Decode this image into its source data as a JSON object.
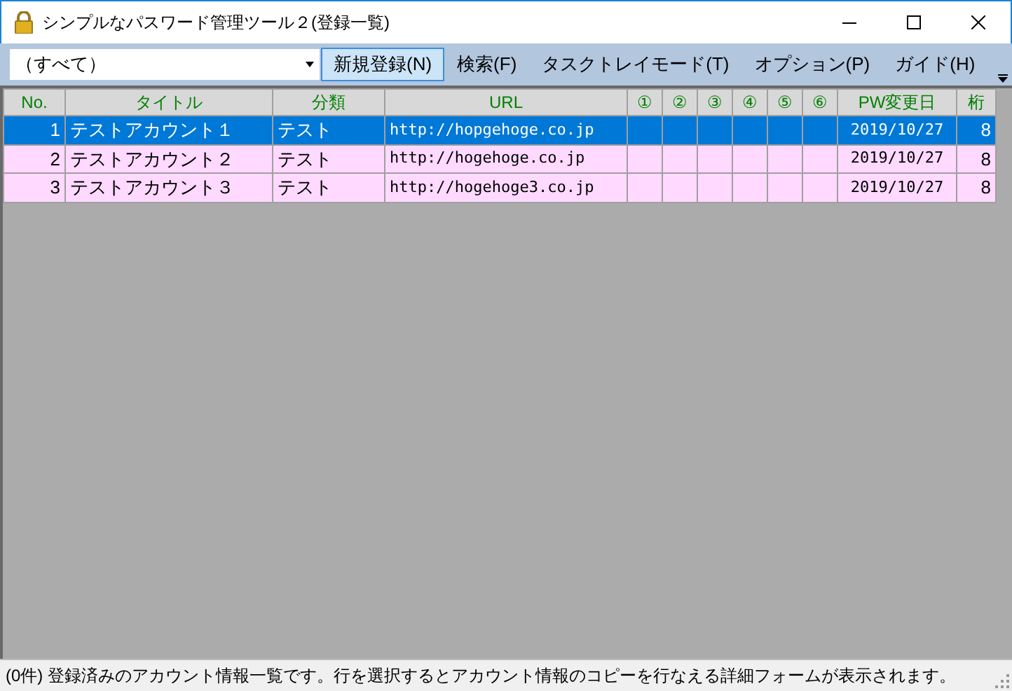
{
  "window": {
    "title": "シンプルなパスワード管理ツール２(登録一覧)"
  },
  "filter": {
    "value": "（すべて）"
  },
  "menu": [
    {
      "label": "新規登録(N)",
      "selected": true
    },
    {
      "label": "検索(F)",
      "selected": false
    },
    {
      "label": "タスクトレイモード(T)",
      "selected": false
    },
    {
      "label": "オプション(P)",
      "selected": false
    },
    {
      "label": "ガイド(H)",
      "selected": false
    }
  ],
  "table": {
    "columns": [
      "No.",
      "タイトル",
      "分類",
      "URL",
      "①",
      "②",
      "③",
      "④",
      "⑤",
      "⑥",
      "PW変更日",
      "桁"
    ],
    "rows": [
      {
        "selected": true,
        "cells": [
          "1",
          "テストアカウント１",
          "テスト",
          "http://hopgehoge.co.jp",
          "",
          "",
          "",
          "",
          "",
          "",
          "2019/10/27",
          "8"
        ]
      },
      {
        "selected": false,
        "cells": [
          "2",
          "テストアカウント２",
          "テスト",
          "http://hogehoge.co.jp",
          "",
          "",
          "",
          "",
          "",
          "",
          "2019/10/27",
          "8"
        ]
      },
      {
        "selected": false,
        "cells": [
          "3",
          "テストアカウント３",
          "テスト",
          "http://hogehoge3.co.jp",
          "",
          "",
          "",
          "",
          "",
          "",
          "2019/10/27",
          "8"
        ]
      }
    ]
  },
  "status_bar": "(0件) 登録済みのアカウント情報一覧です。行を選択するとアカウント情報のコピーを行なえる詳細フォームが表示されます。"
}
